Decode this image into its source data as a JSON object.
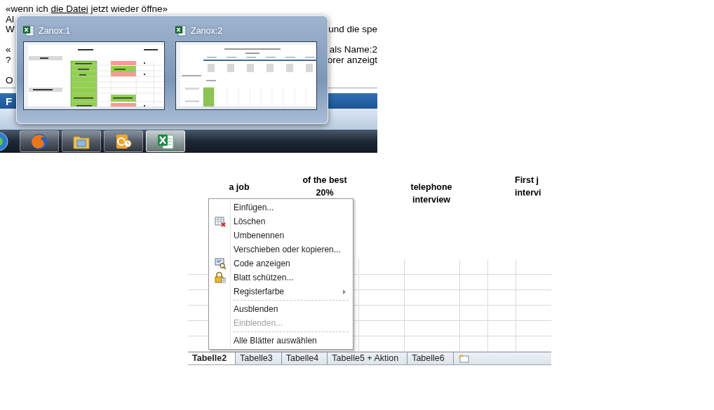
{
  "page_text": {
    "first_line": {
      "before": "«wenn ich ",
      "link": "die Datei",
      "after": " jetzt wieder öffne»"
    },
    "lines": [
      {
        "kind": "text",
        "left": "Al"
      },
      {
        "kind": "text",
        "left": "W",
        "right": "und die spe"
      },
      {
        "kind": "blank"
      },
      {
        "kind": "text",
        "left": "«",
        "right": "als Name:2"
      },
      {
        "kind": "text",
        "left": "?",
        "right": "orer anzeigt"
      },
      {
        "kind": "blank"
      },
      {
        "kind": "text",
        "left": "O"
      }
    ]
  },
  "app_bar": {
    "title": "F"
  },
  "thumbnail_popup": {
    "thumbnails": [
      {
        "title": "Zanox:1",
        "kind": "table"
      },
      {
        "title": "Zanox:2",
        "kind": "overview"
      }
    ]
  },
  "taskbar": {
    "items": [
      {
        "kind": "browser",
        "active": false
      },
      {
        "kind": "folder",
        "active": false
      },
      {
        "kind": "mail",
        "active": false
      },
      {
        "kind": "spreadsheet",
        "active": true
      }
    ]
  },
  "sheet": {
    "headers": [
      {
        "lines": [
          "a job"
        ]
      },
      {
        "lines": [
          "of  the best",
          "20%"
        ]
      },
      {
        "lines": [
          "telephone",
          "interview"
        ]
      },
      {
        "lines": [
          "First j",
          "intervi"
        ]
      }
    ],
    "tabs": [
      {
        "label": "Tabelle2",
        "selected": true
      },
      {
        "label": "Tabelle3",
        "selected": false
      },
      {
        "label": "Tabelle4",
        "selected": false
      },
      {
        "label": "Tabelle5 + Aktion",
        "selected": false
      },
      {
        "label": "Tabelle6",
        "selected": false
      }
    ]
  },
  "context_menu": {
    "items": [
      {
        "kind": "item",
        "label": "Einfügen...",
        "disabled": false
      },
      {
        "kind": "item",
        "label": "Löschen",
        "disabled": false
      },
      {
        "kind": "item",
        "label": "Umbenennen",
        "disabled": false
      },
      {
        "kind": "item",
        "label": "Verschieben oder kopieren...",
        "disabled": false
      },
      {
        "kind": "item",
        "label": "Code anzeigen",
        "disabled": false
      },
      {
        "kind": "item",
        "label": "Blatt schützen...",
        "disabled": false
      },
      {
        "kind": "item",
        "label": "Registerfarbe",
        "submenu": true,
        "disabled": false
      },
      {
        "kind": "separator"
      },
      {
        "kind": "item",
        "label": "Ausblenden",
        "disabled": false
      },
      {
        "kind": "item",
        "label": "Einblenden...",
        "disabled": true
      },
      {
        "kind": "separator"
      },
      {
        "kind": "item",
        "label": "Alle Blätter auswählen",
        "disabled": false
      }
    ]
  }
}
